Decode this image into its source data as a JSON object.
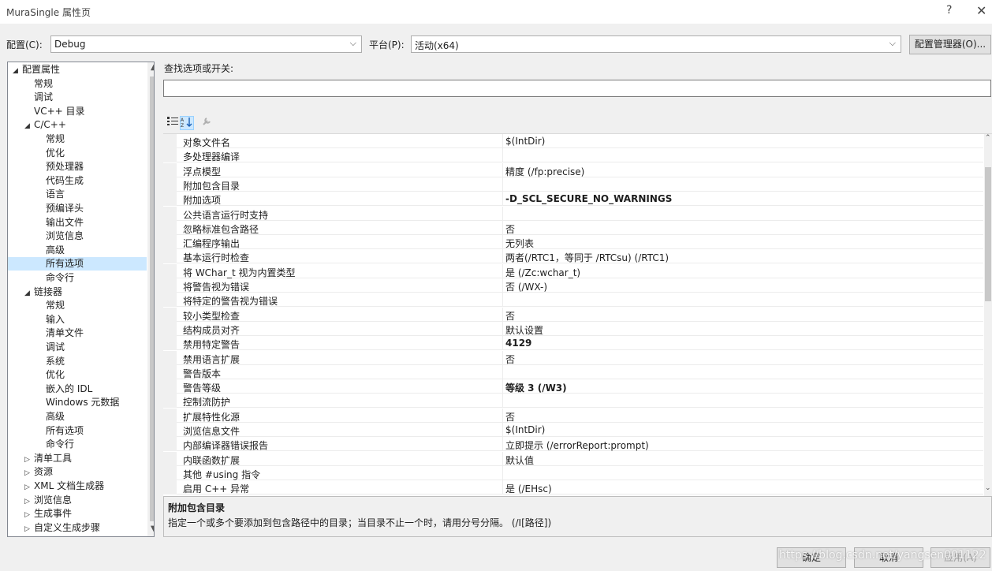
{
  "window": {
    "title": "MuraSingle 属性页",
    "help": "?",
    "close": "✕"
  },
  "config": {
    "label": "配置(C):",
    "value": "Debug"
  },
  "platform": {
    "label": "平台(P):",
    "value": "活动(x64)"
  },
  "config_manager_label": "配置管理器(O)...",
  "tree": [
    {
      "label": "配置属性",
      "toggle": "◢"
    },
    {
      "label": "常规"
    },
    {
      "label": "调试"
    },
    {
      "label": "VC++ 目录"
    },
    {
      "label": "C/C++",
      "toggle": "◢"
    },
    {
      "label": "常规"
    },
    {
      "label": "优化"
    },
    {
      "label": "预处理器"
    },
    {
      "label": "代码生成"
    },
    {
      "label": "语言"
    },
    {
      "label": "预编译头"
    },
    {
      "label": "输出文件"
    },
    {
      "label": "浏览信息"
    },
    {
      "label": "高级"
    },
    {
      "label": "所有选项",
      "selected": true
    },
    {
      "label": "命令行"
    },
    {
      "label": "链接器",
      "toggle": "◢"
    },
    {
      "label": "常规"
    },
    {
      "label": "输入"
    },
    {
      "label": "清单文件"
    },
    {
      "label": "调试"
    },
    {
      "label": "系统"
    },
    {
      "label": "优化"
    },
    {
      "label": "嵌入的 IDL"
    },
    {
      "label": "Windows 元数据"
    },
    {
      "label": "高级"
    },
    {
      "label": "所有选项"
    },
    {
      "label": "命令行"
    },
    {
      "label": "清单工具",
      "toggle": "▷"
    },
    {
      "label": "资源",
      "toggle": "▷"
    },
    {
      "label": "XML 文档生成器",
      "toggle": "▷"
    },
    {
      "label": "浏览信息",
      "toggle": "▷"
    },
    {
      "label": "生成事件",
      "toggle": "▷"
    },
    {
      "label": "自定义生成步骤",
      "toggle": "▷"
    }
  ],
  "search": {
    "label": "查找选项或开关:",
    "value": ""
  },
  "grid_rows": [
    {
      "name": "对象文件名",
      "value": "$(IntDir)"
    },
    {
      "name": "多处理器编译",
      "value": ""
    },
    {
      "name": "浮点模型",
      "value": "精度 (/fp:precise)"
    },
    {
      "name": "附加包含目录",
      "value": ""
    },
    {
      "name": "附加选项",
      "value": "-D_SCL_SECURE_NO_WARNINGS",
      "bold": true
    },
    {
      "name": "公共语言运行时支持",
      "value": ""
    },
    {
      "name": "忽略标准包含路径",
      "value": "否"
    },
    {
      "name": "汇编程序输出",
      "value": "无列表"
    },
    {
      "name": "基本运行时检查",
      "value": "两者(/RTC1，等同于 /RTCsu) (/RTC1)"
    },
    {
      "name": "将 WChar_t 视为内置类型",
      "value": "是 (/Zc:wchar_t)"
    },
    {
      "name": "将警告视为错误",
      "value": "否 (/WX-)"
    },
    {
      "name": "将特定的警告视为错误",
      "value": ""
    },
    {
      "name": "较小类型检查",
      "value": "否"
    },
    {
      "name": "结构成员对齐",
      "value": "默认设置"
    },
    {
      "name": "禁用特定警告",
      "value": "4129",
      "bold": true
    },
    {
      "name": "禁用语言扩展",
      "value": "否"
    },
    {
      "name": "警告版本",
      "value": ""
    },
    {
      "name": "警告等级",
      "value": "等级 3 (/W3)",
      "bold": true
    },
    {
      "name": "控制流防护",
      "value": ""
    },
    {
      "name": "扩展特性化源",
      "value": "否"
    },
    {
      "name": "浏览信息文件",
      "value": "$(IntDir)"
    },
    {
      "name": "内部编译器错误报告",
      "value": "立即提示 (/errorReport:prompt)"
    },
    {
      "name": "内联函数扩展",
      "value": "默认值"
    },
    {
      "name": "其他 #using 指令",
      "value": ""
    },
    {
      "name": "启用 C++ 异常",
      "value": "是 (/EHsc)"
    }
  ],
  "description": {
    "title": "附加包含目录",
    "text": "指定一个或多个要添加到包含路径中的目录；当目录不止一个时，请用分号分隔。     (/I[路径])"
  },
  "buttons": {
    "ok": "确定",
    "cancel": "取消",
    "apply": "应用(A)"
  },
  "watermark": "https://blog.csdn.net/yangsen001122",
  "icons": {
    "categorized": "categorized-icon",
    "alphabetical": "alphabetical-icon",
    "property_pages": "wrench-icon"
  }
}
